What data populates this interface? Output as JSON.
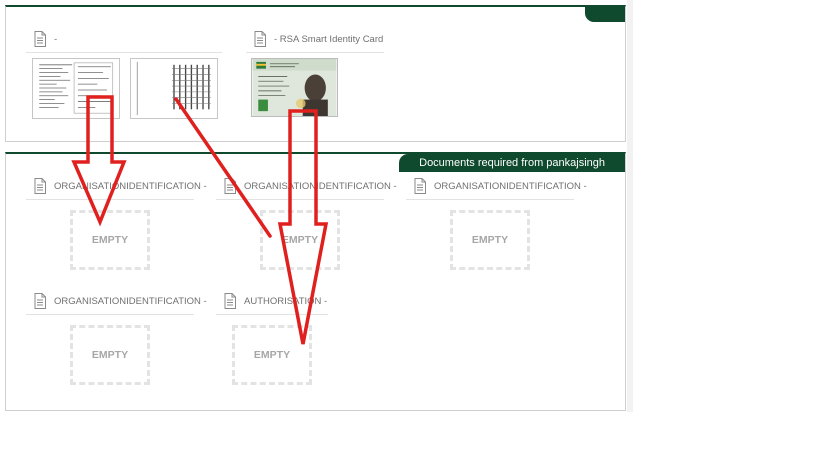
{
  "uploaded_documents": [
    {
      "label": "-",
      "icon": "file-icon"
    },
    {
      "label": "- RSA Smart Identity Card",
      "icon": "file-icon"
    }
  ],
  "required_section": {
    "tab_label": "Documents required from pankajsingh",
    "items": [
      {
        "label": "ORGANISATIONIDENTIFICATION -",
        "status": "EMPTY"
      },
      {
        "label": "ORGANISATIONIDENTIFICATION -",
        "status": "EMPTY"
      },
      {
        "label": "ORGANISATIONIDENTIFICATION -",
        "status": "EMPTY"
      },
      {
        "label": "ORGANISATIONIDENTIFICATION -",
        "status": "EMPTY"
      },
      {
        "label": "AUTHORISATION -",
        "status": "EMPTY"
      }
    ]
  },
  "colors": {
    "brand_green": "#0f4a2e",
    "annotation_red": "#e0201e",
    "empty_border": "#e3e3e3"
  }
}
